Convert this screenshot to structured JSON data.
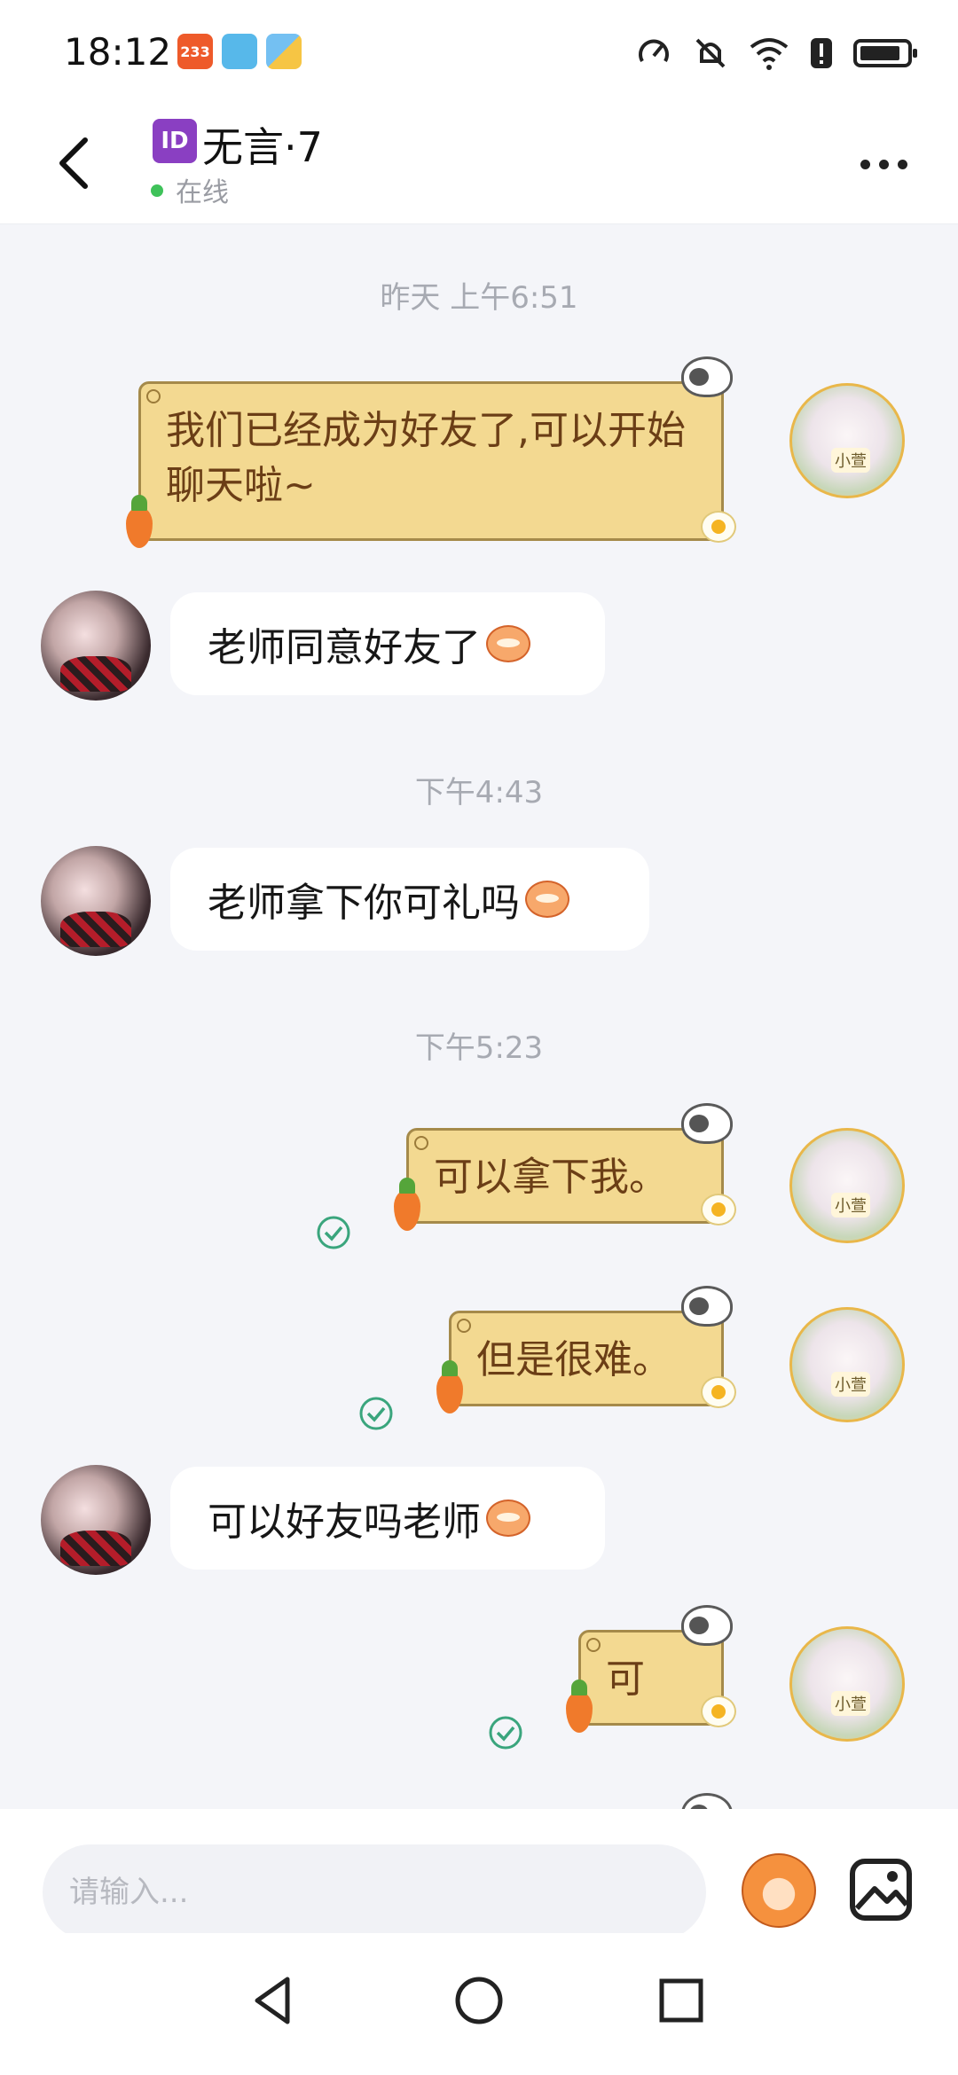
{
  "status_bar": {
    "time": "18:12",
    "notif_badge": "233",
    "notif_icons": [
      "notification-233-icon",
      "book-app-icon",
      "weather-app-icon"
    ],
    "right_icons": [
      "speed-icon",
      "mute-icon",
      "wifi-icon",
      "alert-icon",
      "battery-icon"
    ],
    "battery_level": 0.9
  },
  "header": {
    "id_badge": "ID",
    "name": "无言·7",
    "status": "在线",
    "status_color": "#3fc25a"
  },
  "messages": [
    {
      "type": "timestamp",
      "text": "昨天 上午6:51"
    },
    {
      "type": "outgoing",
      "text": "我们已经成为好友了,可以开始聊天啦~"
    },
    {
      "type": "incoming",
      "text": "老师同意好友了",
      "emoji": "monkey-laugh-icon"
    },
    {
      "type": "timestamp",
      "text": "下午4:43"
    },
    {
      "type": "incoming",
      "text": "老师拿下你可礼吗",
      "emoji": "monkey-laugh-icon"
    },
    {
      "type": "timestamp",
      "text": "下午5:23"
    },
    {
      "type": "outgoing",
      "text": "可以拿下我。",
      "read": true
    },
    {
      "type": "outgoing",
      "text": "但是很难。",
      "read": true
    },
    {
      "type": "incoming",
      "text": "可以好友吗老师",
      "emoji": "monkey-shock-icon"
    },
    {
      "type": "outgoing",
      "text": "可",
      "read": true
    }
  ],
  "avatar_tag": "小萱",
  "input": {
    "placeholder": "请输入..."
  },
  "theme": {
    "bubble_out_bg": "#f3d991",
    "bubble_out_border": "#a58a4a",
    "bubble_out_text": "#6b3e16",
    "read_check": "#3aa57d",
    "page_bg": "#f4f5f9"
  }
}
